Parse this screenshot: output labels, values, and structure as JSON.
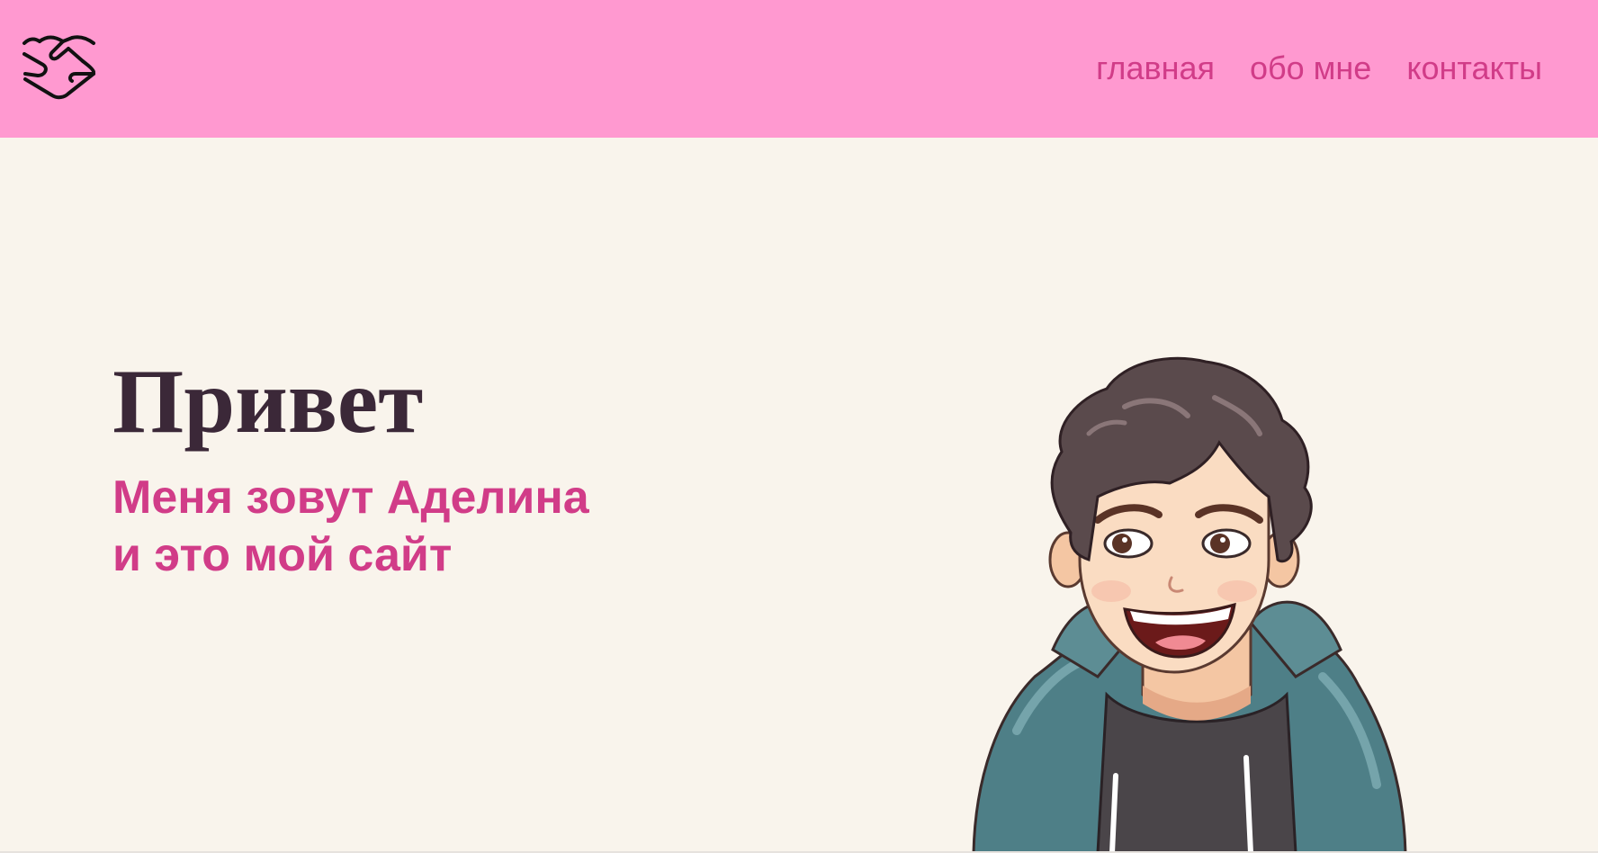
{
  "header": {
    "logo_icon": "handshake-icon",
    "nav": [
      {
        "label": "главная"
      },
      {
        "label": "обо мне"
      },
      {
        "label": "контакты"
      }
    ]
  },
  "hero": {
    "title": "Привет",
    "subtitle_line1": "Меня зовут Аделина",
    "subtitle_line2": "и это мой сайт",
    "illustration_icon": "cartoon-person-illustration"
  },
  "colors": {
    "header_bg": "#ff99d0",
    "page_bg": "#f9f4ec",
    "accent": "#d13c88",
    "title": "#3b2838"
  }
}
